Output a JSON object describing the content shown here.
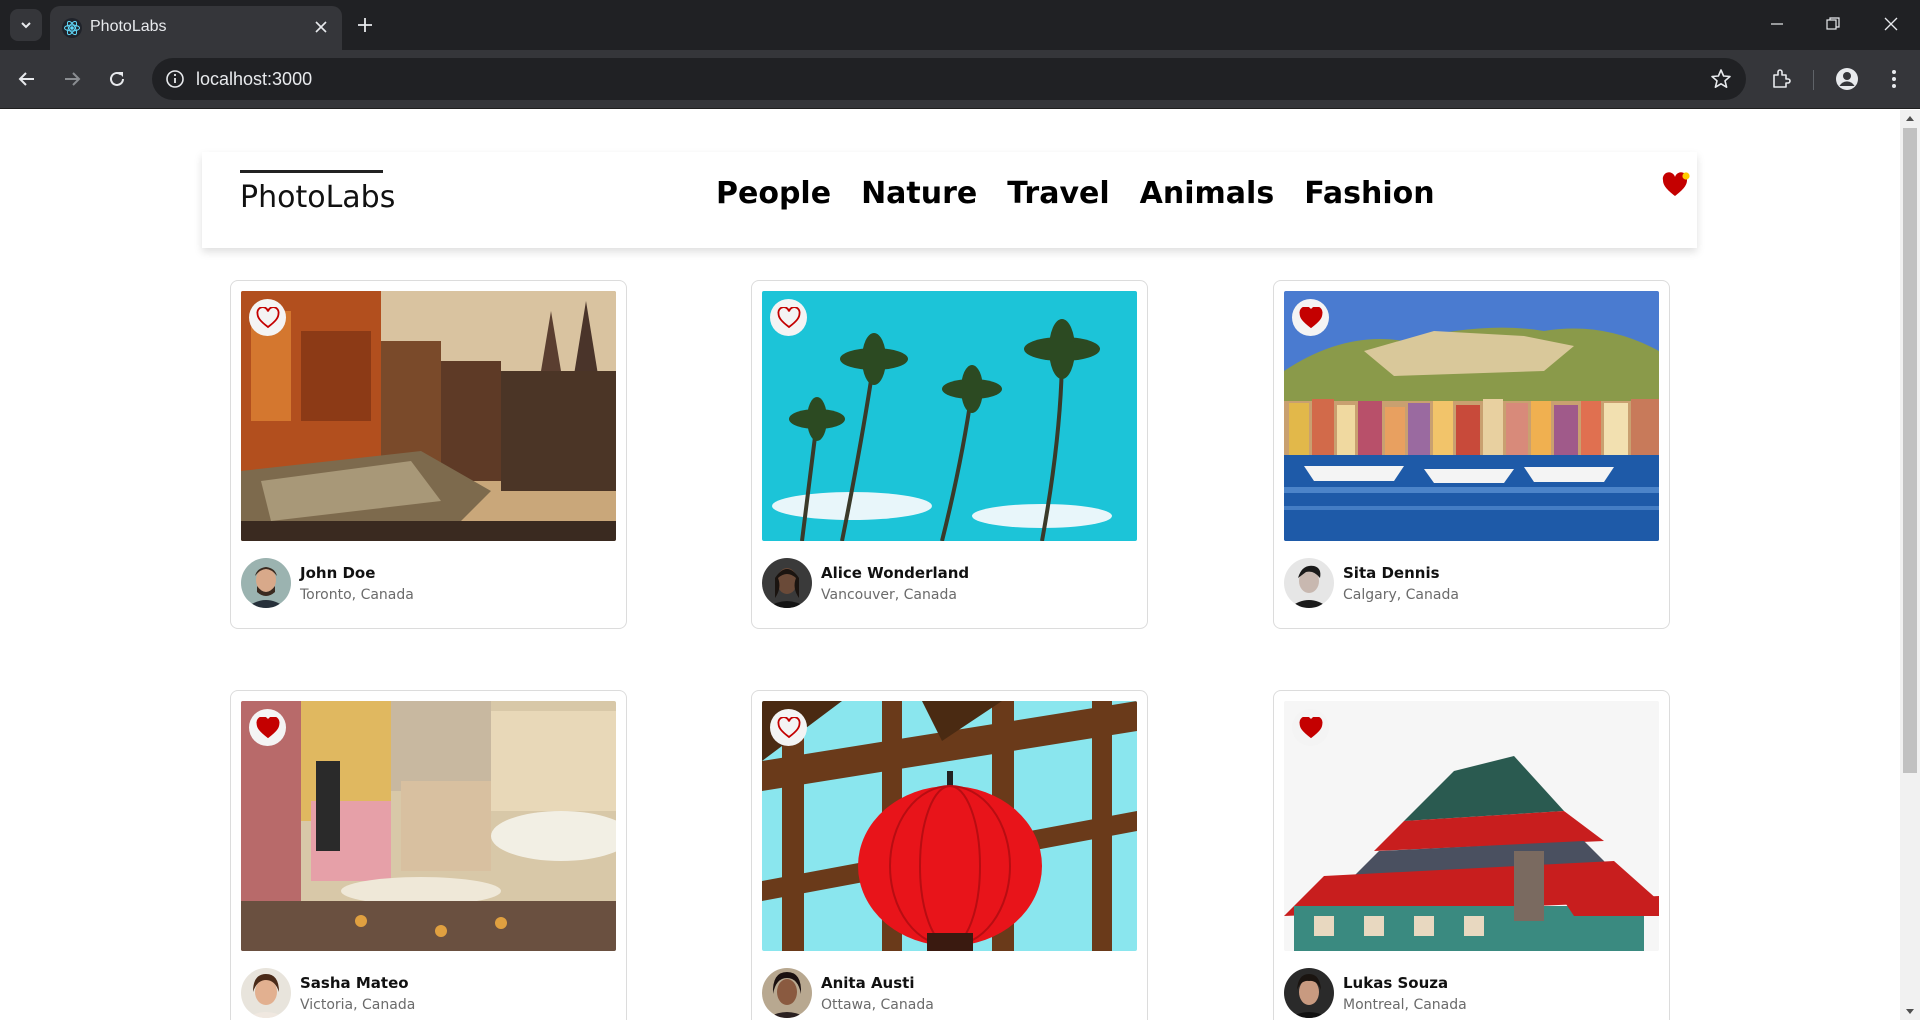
{
  "browser": {
    "tab_title": "PhotoLabs",
    "url": "localhost:3000",
    "icons": [
      "tab-search-icon",
      "react-favicon",
      "close-icon",
      "plus-icon",
      "minimize-icon",
      "restore-icon",
      "window-close-icon",
      "back-icon",
      "forward-icon",
      "reload-icon",
      "site-info-icon",
      "bookmark-star-icon",
      "extensions-icon",
      "profile-icon",
      "menu-icon"
    ]
  },
  "app": {
    "logo": "PhotoLabs",
    "topics": [
      "People",
      "Nature",
      "Travel",
      "Animals",
      "Fashion"
    ],
    "fav_badge": {
      "icon": "heart-icon",
      "has_notification": true,
      "color": "#c40000",
      "dot_color": "#ffcc00"
    }
  },
  "photos": [
    {
      "username": "John Doe",
      "location": "Toronto, Canada",
      "favorited": false,
      "image": "old-city-buildings"
    },
    {
      "username": "Alice Wonderland",
      "location": "Vancouver, Canada",
      "favorited": false,
      "image": "palm-trees-blue-sky"
    },
    {
      "username": "Sita Dennis",
      "location": "Calgary, Canada",
      "favorited": true,
      "image": "harbour-town-boats"
    },
    {
      "username": "Sasha Mateo",
      "location": "Victoria, Canada",
      "favorited": true,
      "image": "colorful-street-market"
    },
    {
      "username": "Anita Austi",
      "location": "Ottawa, Canada",
      "favorited": false,
      "image": "red-lantern-pergola"
    },
    {
      "username": "Lukas Souza",
      "location": "Montreal, Canada",
      "favorited": true,
      "image": "chinese-pagoda-roof"
    }
  ],
  "colors": {
    "heart_red": "#c40000",
    "chrome_dark": "#202124",
    "chrome_mid": "#35363a"
  }
}
